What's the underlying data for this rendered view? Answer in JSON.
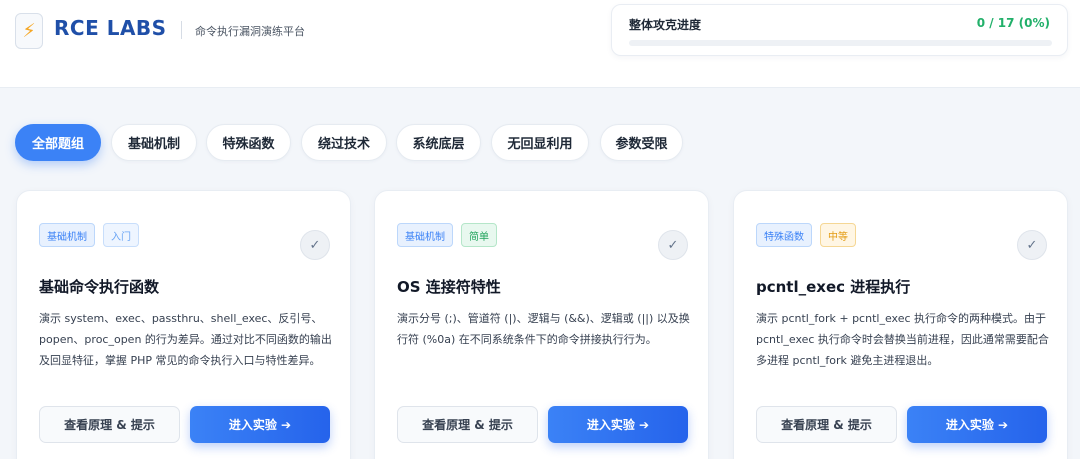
{
  "header": {
    "logo_icon": "lightning-icon",
    "brand": "RCE LABS",
    "subtitle": "命令执行漏洞演练平台"
  },
  "progress": {
    "label": "整体攻克进度",
    "value_text": "0 / 17 (0%)",
    "fraction": 0,
    "color": "#22b06a"
  },
  "tabs": [
    {
      "label": "全部题组",
      "active": true
    },
    {
      "label": "基础机制",
      "active": false
    },
    {
      "label": "特殊函数",
      "active": false
    },
    {
      "label": "绕过技术",
      "active": false
    },
    {
      "label": "系统底层",
      "active": false
    },
    {
      "label": "无回显利用",
      "active": false
    },
    {
      "label": "参数受限",
      "active": false
    }
  ],
  "cards": [
    {
      "category": "基础机制",
      "level": "入门",
      "title": "基础命令执行函数",
      "desc": "演示 system、exec、passthru、shell_exec、反引号、popen、proc_open 的行为差异。通过对比不同函数的输出及回显特征，掌握 PHP 常见的命令执行入口与特性差异。",
      "hint_button": "查看原理 & 提示",
      "enter_button": "进入实验 ➔",
      "check_icon": "check-icon"
    },
    {
      "category": "基础机制",
      "level": "简单",
      "title": "OS 连接符特性",
      "desc": "演示分号 (;)、管道符 (|)、逻辑与 (&&)、逻辑或 (||) 以及换行符 (%0a) 在不同系统条件下的命令拼接执行行为。",
      "hint_button": "查看原理 & 提示",
      "enter_button": "进入实验 ➔",
      "check_icon": "check-icon"
    },
    {
      "category": "特殊函数",
      "level": "中等",
      "title": "pcntl_exec 进程执行",
      "desc": "演示 pcntl_fork + pcntl_exec 执行命令的两种模式。由于 pcntl_exec 执行命令时会替换当前进程，因此通常需要配合多进程 pcntl_fork 避免主进程退出。",
      "hint_button": "查看原理 & 提示",
      "enter_button": "进入实验 ➔",
      "check_icon": "check-icon"
    }
  ]
}
